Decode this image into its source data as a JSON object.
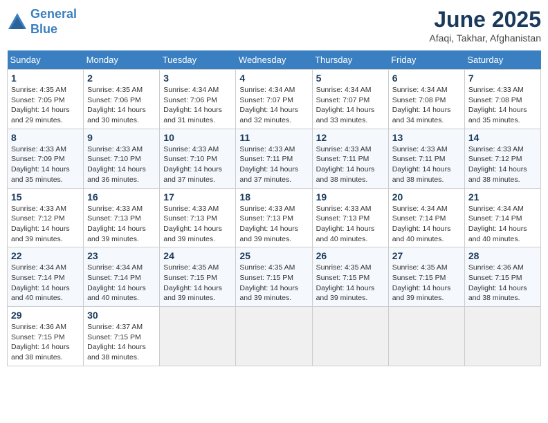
{
  "header": {
    "logo_line1": "General",
    "logo_line2": "Blue",
    "month": "June 2025",
    "location": "Afaqi, Takhar, Afghanistan"
  },
  "weekdays": [
    "Sunday",
    "Monday",
    "Tuesday",
    "Wednesday",
    "Thursday",
    "Friday",
    "Saturday"
  ],
  "weeks": [
    [
      {
        "day": "1",
        "info": "Sunrise: 4:35 AM\nSunset: 7:05 PM\nDaylight: 14 hours\nand 29 minutes."
      },
      {
        "day": "2",
        "info": "Sunrise: 4:35 AM\nSunset: 7:06 PM\nDaylight: 14 hours\nand 30 minutes."
      },
      {
        "day": "3",
        "info": "Sunrise: 4:34 AM\nSunset: 7:06 PM\nDaylight: 14 hours\nand 31 minutes."
      },
      {
        "day": "4",
        "info": "Sunrise: 4:34 AM\nSunset: 7:07 PM\nDaylight: 14 hours\nand 32 minutes."
      },
      {
        "day": "5",
        "info": "Sunrise: 4:34 AM\nSunset: 7:07 PM\nDaylight: 14 hours\nand 33 minutes."
      },
      {
        "day": "6",
        "info": "Sunrise: 4:34 AM\nSunset: 7:08 PM\nDaylight: 14 hours\nand 34 minutes."
      },
      {
        "day": "7",
        "info": "Sunrise: 4:33 AM\nSunset: 7:08 PM\nDaylight: 14 hours\nand 35 minutes."
      }
    ],
    [
      {
        "day": "8",
        "info": "Sunrise: 4:33 AM\nSunset: 7:09 PM\nDaylight: 14 hours\nand 35 minutes."
      },
      {
        "day": "9",
        "info": "Sunrise: 4:33 AM\nSunset: 7:10 PM\nDaylight: 14 hours\nand 36 minutes."
      },
      {
        "day": "10",
        "info": "Sunrise: 4:33 AM\nSunset: 7:10 PM\nDaylight: 14 hours\nand 37 minutes."
      },
      {
        "day": "11",
        "info": "Sunrise: 4:33 AM\nSunset: 7:11 PM\nDaylight: 14 hours\nand 37 minutes."
      },
      {
        "day": "12",
        "info": "Sunrise: 4:33 AM\nSunset: 7:11 PM\nDaylight: 14 hours\nand 38 minutes."
      },
      {
        "day": "13",
        "info": "Sunrise: 4:33 AM\nSunset: 7:11 PM\nDaylight: 14 hours\nand 38 minutes."
      },
      {
        "day": "14",
        "info": "Sunrise: 4:33 AM\nSunset: 7:12 PM\nDaylight: 14 hours\nand 38 minutes."
      }
    ],
    [
      {
        "day": "15",
        "info": "Sunrise: 4:33 AM\nSunset: 7:12 PM\nDaylight: 14 hours\nand 39 minutes."
      },
      {
        "day": "16",
        "info": "Sunrise: 4:33 AM\nSunset: 7:13 PM\nDaylight: 14 hours\nand 39 minutes."
      },
      {
        "day": "17",
        "info": "Sunrise: 4:33 AM\nSunset: 7:13 PM\nDaylight: 14 hours\nand 39 minutes."
      },
      {
        "day": "18",
        "info": "Sunrise: 4:33 AM\nSunset: 7:13 PM\nDaylight: 14 hours\nand 39 minutes."
      },
      {
        "day": "19",
        "info": "Sunrise: 4:33 AM\nSunset: 7:13 PM\nDaylight: 14 hours\nand 40 minutes."
      },
      {
        "day": "20",
        "info": "Sunrise: 4:34 AM\nSunset: 7:14 PM\nDaylight: 14 hours\nand 40 minutes."
      },
      {
        "day": "21",
        "info": "Sunrise: 4:34 AM\nSunset: 7:14 PM\nDaylight: 14 hours\nand 40 minutes."
      }
    ],
    [
      {
        "day": "22",
        "info": "Sunrise: 4:34 AM\nSunset: 7:14 PM\nDaylight: 14 hours\nand 40 minutes."
      },
      {
        "day": "23",
        "info": "Sunrise: 4:34 AM\nSunset: 7:14 PM\nDaylight: 14 hours\nand 40 minutes."
      },
      {
        "day": "24",
        "info": "Sunrise: 4:35 AM\nSunset: 7:15 PM\nDaylight: 14 hours\nand 39 minutes."
      },
      {
        "day": "25",
        "info": "Sunrise: 4:35 AM\nSunset: 7:15 PM\nDaylight: 14 hours\nand 39 minutes."
      },
      {
        "day": "26",
        "info": "Sunrise: 4:35 AM\nSunset: 7:15 PM\nDaylight: 14 hours\nand 39 minutes."
      },
      {
        "day": "27",
        "info": "Sunrise: 4:35 AM\nSunset: 7:15 PM\nDaylight: 14 hours\nand 39 minutes."
      },
      {
        "day": "28",
        "info": "Sunrise: 4:36 AM\nSunset: 7:15 PM\nDaylight: 14 hours\nand 38 minutes."
      }
    ],
    [
      {
        "day": "29",
        "info": "Sunrise: 4:36 AM\nSunset: 7:15 PM\nDaylight: 14 hours\nand 38 minutes."
      },
      {
        "day": "30",
        "info": "Sunrise: 4:37 AM\nSunset: 7:15 PM\nDaylight: 14 hours\nand 38 minutes."
      },
      {
        "day": "",
        "info": ""
      },
      {
        "day": "",
        "info": ""
      },
      {
        "day": "",
        "info": ""
      },
      {
        "day": "",
        "info": ""
      },
      {
        "day": "",
        "info": ""
      }
    ]
  ]
}
